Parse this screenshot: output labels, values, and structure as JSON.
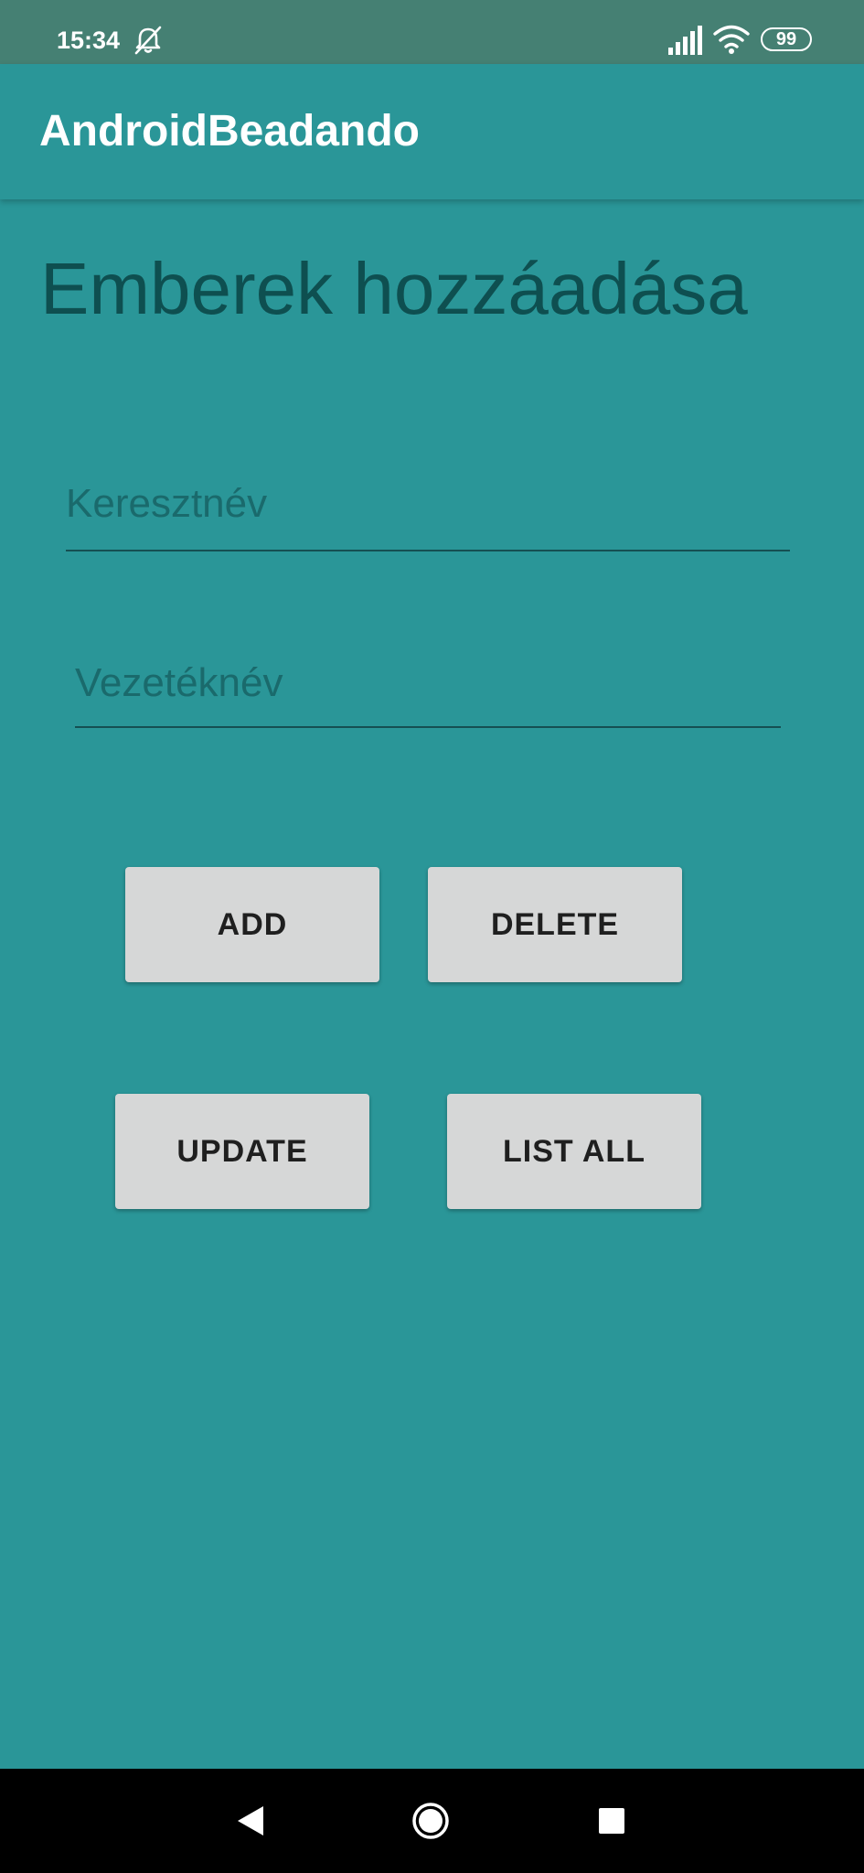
{
  "status_bar": {
    "time": "15:34",
    "dnd_icon": "notifications-off-icon",
    "signal_icon": "signal-icon",
    "wifi_icon": "wifi-icon",
    "battery_level": "99"
  },
  "app_bar": {
    "title": "AndroidBeadando"
  },
  "main": {
    "heading": "Emberek hozzáadása",
    "first_name_placeholder": "Keresztnév",
    "first_name_value": "",
    "last_name_placeholder": "Vezetéknév",
    "last_name_value": "",
    "buttons": {
      "add": "ADD",
      "delete": "DELETE",
      "update": "UPDATE",
      "list_all": "LIST ALL"
    }
  },
  "colors": {
    "background": "#2a9698",
    "status_bar": "#458073",
    "heading_text": "#0e4f50",
    "button_bg": "#d6d7d7",
    "nav_bar": "#000000"
  },
  "nav_bar": {
    "back_icon": "back-triangle-icon",
    "home_icon": "home-circle-icon",
    "recents_icon": "recents-square-icon"
  }
}
